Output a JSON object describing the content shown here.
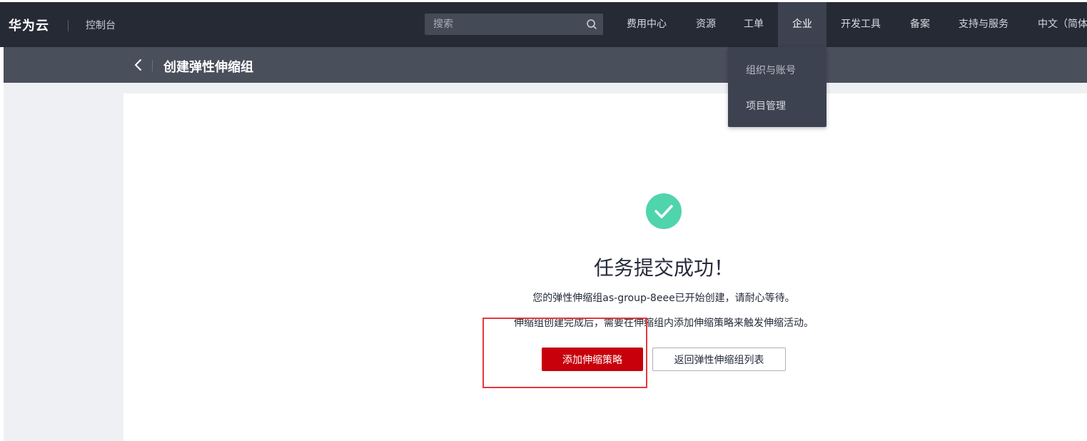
{
  "header": {
    "logo": "华为云",
    "console": "控制台",
    "search": {
      "value": "",
      "placeholder": "搜索"
    },
    "nav": {
      "billing": "费用中心",
      "resources": "资源",
      "tickets": "工单",
      "enterprise": "企业",
      "devtools": "开发工具",
      "filing": "备案",
      "support": "支持与服务",
      "language": "中文（简体"
    }
  },
  "dropdown": {
    "items": [
      "组织与账号",
      "项目管理"
    ]
  },
  "subheader": {
    "title": "创建弹性伸缩组"
  },
  "result": {
    "title": "任务提交成功！",
    "description": "您的弹性伸缩组as-group-8eee已开始创建，请耐心等待。",
    "hint": "伸缩组创建完成后，需要在伸缩组内添加伸缩策略来触发伸缩活动。",
    "primary_button": "添加伸缩策略",
    "secondary_button": "返回弹性伸缩组列表"
  },
  "icons": {
    "search": "search-icon",
    "back": "chevron-left-icon",
    "success": "check-circle-icon"
  },
  "colors": {
    "topbar": "#262a35",
    "subbar": "#4a4f5c",
    "primary": "#c7000b",
    "success": "#50d4ab",
    "highlight": "#e8383d"
  }
}
